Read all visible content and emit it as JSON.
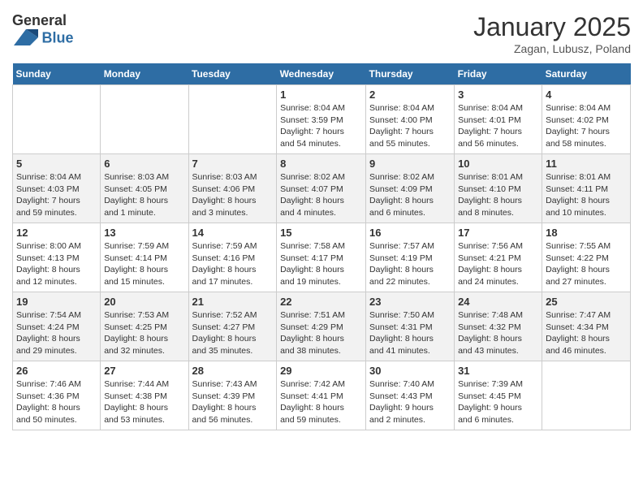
{
  "header": {
    "logo_general": "General",
    "logo_blue": "Blue",
    "title": "January 2025",
    "subtitle": "Zagan, Lubusz, Poland"
  },
  "calendar": {
    "days_of_week": [
      "Sunday",
      "Monday",
      "Tuesday",
      "Wednesday",
      "Thursday",
      "Friday",
      "Saturday"
    ],
    "weeks": [
      {
        "days": [
          {
            "num": "",
            "info": ""
          },
          {
            "num": "",
            "info": ""
          },
          {
            "num": "",
            "info": ""
          },
          {
            "num": "1",
            "info": "Sunrise: 8:04 AM\nSunset: 3:59 PM\nDaylight: 7 hours\nand 54 minutes."
          },
          {
            "num": "2",
            "info": "Sunrise: 8:04 AM\nSunset: 4:00 PM\nDaylight: 7 hours\nand 55 minutes."
          },
          {
            "num": "3",
            "info": "Sunrise: 8:04 AM\nSunset: 4:01 PM\nDaylight: 7 hours\nand 56 minutes."
          },
          {
            "num": "4",
            "info": "Sunrise: 8:04 AM\nSunset: 4:02 PM\nDaylight: 7 hours\nand 58 minutes."
          }
        ]
      },
      {
        "days": [
          {
            "num": "5",
            "info": "Sunrise: 8:04 AM\nSunset: 4:03 PM\nDaylight: 7 hours\nand 59 minutes."
          },
          {
            "num": "6",
            "info": "Sunrise: 8:03 AM\nSunset: 4:05 PM\nDaylight: 8 hours\nand 1 minute."
          },
          {
            "num": "7",
            "info": "Sunrise: 8:03 AM\nSunset: 4:06 PM\nDaylight: 8 hours\nand 3 minutes."
          },
          {
            "num": "8",
            "info": "Sunrise: 8:02 AM\nSunset: 4:07 PM\nDaylight: 8 hours\nand 4 minutes."
          },
          {
            "num": "9",
            "info": "Sunrise: 8:02 AM\nSunset: 4:09 PM\nDaylight: 8 hours\nand 6 minutes."
          },
          {
            "num": "10",
            "info": "Sunrise: 8:01 AM\nSunset: 4:10 PM\nDaylight: 8 hours\nand 8 minutes."
          },
          {
            "num": "11",
            "info": "Sunrise: 8:01 AM\nSunset: 4:11 PM\nDaylight: 8 hours\nand 10 minutes."
          }
        ]
      },
      {
        "days": [
          {
            "num": "12",
            "info": "Sunrise: 8:00 AM\nSunset: 4:13 PM\nDaylight: 8 hours\nand 12 minutes."
          },
          {
            "num": "13",
            "info": "Sunrise: 7:59 AM\nSunset: 4:14 PM\nDaylight: 8 hours\nand 15 minutes."
          },
          {
            "num": "14",
            "info": "Sunrise: 7:59 AM\nSunset: 4:16 PM\nDaylight: 8 hours\nand 17 minutes."
          },
          {
            "num": "15",
            "info": "Sunrise: 7:58 AM\nSunset: 4:17 PM\nDaylight: 8 hours\nand 19 minutes."
          },
          {
            "num": "16",
            "info": "Sunrise: 7:57 AM\nSunset: 4:19 PM\nDaylight: 8 hours\nand 22 minutes."
          },
          {
            "num": "17",
            "info": "Sunrise: 7:56 AM\nSunset: 4:21 PM\nDaylight: 8 hours\nand 24 minutes."
          },
          {
            "num": "18",
            "info": "Sunrise: 7:55 AM\nSunset: 4:22 PM\nDaylight: 8 hours\nand 27 minutes."
          }
        ]
      },
      {
        "days": [
          {
            "num": "19",
            "info": "Sunrise: 7:54 AM\nSunset: 4:24 PM\nDaylight: 8 hours\nand 29 minutes."
          },
          {
            "num": "20",
            "info": "Sunrise: 7:53 AM\nSunset: 4:25 PM\nDaylight: 8 hours\nand 32 minutes."
          },
          {
            "num": "21",
            "info": "Sunrise: 7:52 AM\nSunset: 4:27 PM\nDaylight: 8 hours\nand 35 minutes."
          },
          {
            "num": "22",
            "info": "Sunrise: 7:51 AM\nSunset: 4:29 PM\nDaylight: 8 hours\nand 38 minutes."
          },
          {
            "num": "23",
            "info": "Sunrise: 7:50 AM\nSunset: 4:31 PM\nDaylight: 8 hours\nand 41 minutes."
          },
          {
            "num": "24",
            "info": "Sunrise: 7:48 AM\nSunset: 4:32 PM\nDaylight: 8 hours\nand 43 minutes."
          },
          {
            "num": "25",
            "info": "Sunrise: 7:47 AM\nSunset: 4:34 PM\nDaylight: 8 hours\nand 46 minutes."
          }
        ]
      },
      {
        "days": [
          {
            "num": "26",
            "info": "Sunrise: 7:46 AM\nSunset: 4:36 PM\nDaylight: 8 hours\nand 50 minutes."
          },
          {
            "num": "27",
            "info": "Sunrise: 7:44 AM\nSunset: 4:38 PM\nDaylight: 8 hours\nand 53 minutes."
          },
          {
            "num": "28",
            "info": "Sunrise: 7:43 AM\nSunset: 4:39 PM\nDaylight: 8 hours\nand 56 minutes."
          },
          {
            "num": "29",
            "info": "Sunrise: 7:42 AM\nSunset: 4:41 PM\nDaylight: 8 hours\nand 59 minutes."
          },
          {
            "num": "30",
            "info": "Sunrise: 7:40 AM\nSunset: 4:43 PM\nDaylight: 9 hours\nand 2 minutes."
          },
          {
            "num": "31",
            "info": "Sunrise: 7:39 AM\nSunset: 4:45 PM\nDaylight: 9 hours\nand 6 minutes."
          },
          {
            "num": "",
            "info": ""
          }
        ]
      }
    ]
  }
}
